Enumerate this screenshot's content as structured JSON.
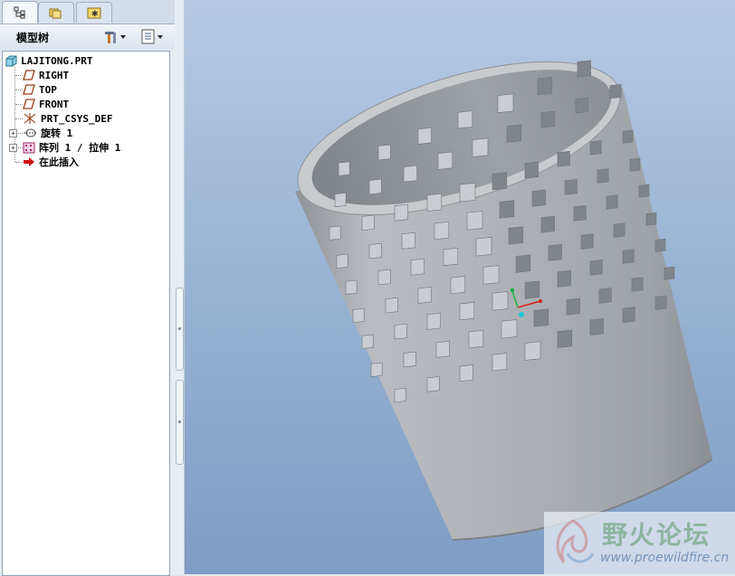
{
  "left_panel": {
    "tabs": [
      {
        "icon": "model-tree-icon",
        "active": true
      },
      {
        "icon": "folder-browser-icon",
        "active": false
      },
      {
        "icon": "favorites-icon",
        "active": false
      }
    ],
    "header": {
      "title": "模型树",
      "settings_icon": "tools-icon",
      "show_icon": "show-list-icon"
    },
    "tree": {
      "root": "LAJITONG.PRT",
      "items": [
        {
          "label": "RIGHT",
          "icon": "datum-plane-icon"
        },
        {
          "label": "TOP",
          "icon": "datum-plane-icon"
        },
        {
          "label": "FRONT",
          "icon": "datum-plane-icon"
        },
        {
          "label": "PRT_CSYS_DEF",
          "icon": "csys-icon"
        },
        {
          "label": "旋转 1",
          "icon": "revolve-icon",
          "expandable": true
        },
        {
          "label": "阵列 1 / 拉伸 1",
          "icon": "pattern-icon",
          "expandable": true
        },
        {
          "label": "在此插入",
          "icon": "insert-here-icon"
        }
      ]
    }
  },
  "watermark": {
    "title": "野火论坛",
    "url": "www.proewildfire.cn"
  },
  "colors": {
    "viewport_top": "#b5c9e2",
    "viewport_bottom": "#7f9cc4",
    "model_gray": "#a9aeb3",
    "insert_arrow": "#cc1010"
  }
}
